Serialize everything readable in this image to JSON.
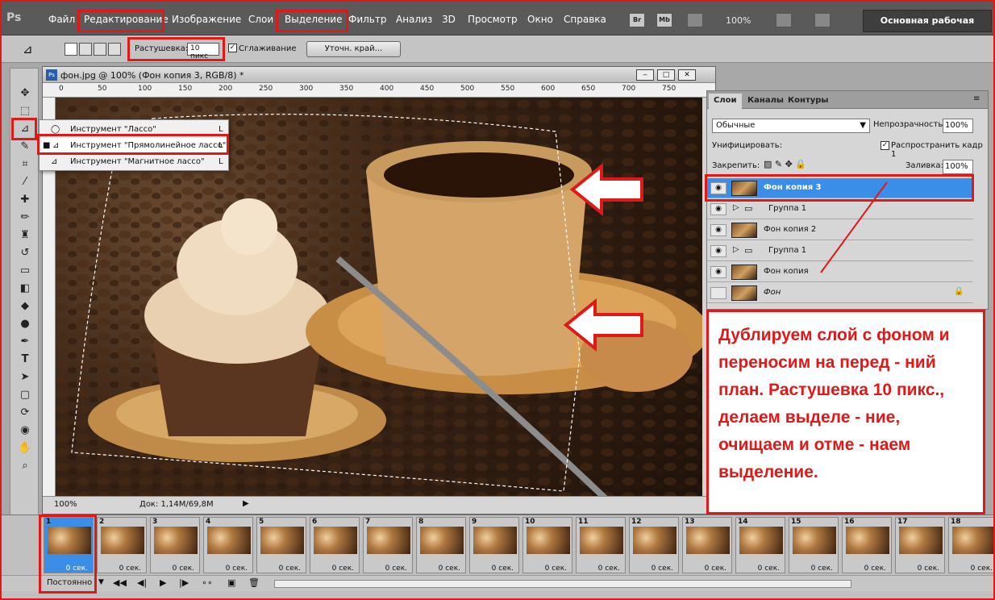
{
  "app": {
    "logo": "Ps"
  },
  "menu": [
    "Файл",
    "Редактирование",
    "Изображение",
    "Слои",
    "Выделение",
    "Фильтр",
    "Анализ",
    "3D",
    "Просмотр",
    "Окно",
    "Справка"
  ],
  "menu_right": {
    "br": "Br",
    "mb": "Mb",
    "zoom": "100%",
    "workspace": "Основная рабочая среда"
  },
  "options": {
    "feather_label": "Растушевка:",
    "feather_value": "10 пикс",
    "antialias_label": "Сглаживание",
    "refine_button": "Уточн. край..."
  },
  "document": {
    "title": "фон.jpg @ 100% (Фон копия 3, RGB/8) *",
    "zoom": "100%",
    "doc_size": "Док: 1,14М/69,8М",
    "ruler_ticks": [
      "0",
      "50",
      "100",
      "150",
      "200",
      "250",
      "300",
      "350",
      "400",
      "450",
      "500",
      "550",
      "600",
      "650",
      "700",
      "750"
    ]
  },
  "flyout": {
    "items": [
      {
        "label": "Инструмент \"Лассо\"",
        "key": "L"
      },
      {
        "label": "Инструмент \"Прямолинейное лассо\"",
        "key": "L"
      },
      {
        "label": "Инструмент \"Магнитное лассо\"",
        "key": "L"
      }
    ]
  },
  "layers_panel": {
    "tabs": [
      "Слои",
      "Каналы",
      "Контуры"
    ],
    "blend_mode": "Обычные",
    "opacity_label": "Непрозрачность:",
    "opacity_value": "100%",
    "unify_label": "Унифицировать:",
    "propagate_label": "Распространить кадр 1",
    "lock_label": "Закрепить:",
    "fill_label": "Заливка:",
    "fill_value": "100%",
    "layers": [
      {
        "name": "Фон копия 3",
        "selected": true
      },
      {
        "name": "Группа 1",
        "group": true
      },
      {
        "name": "Фон копия 2"
      },
      {
        "name": "Группа 1",
        "group": true
      },
      {
        "name": "Фон копия"
      },
      {
        "name": "Фон",
        "locked": true
      }
    ]
  },
  "annotation": "Дублируем слой с фоном и переносим на перед - ний план. Растушевка 10 пикс., делаем выделе - ние, очищаем и отме - наем выделение.",
  "timeline": {
    "frames": [
      {
        "num": "1",
        "time": "0 сек."
      },
      {
        "num": "2",
        "time": "0 сек."
      },
      {
        "num": "3",
        "time": "0 сек."
      },
      {
        "num": "4",
        "time": "0 сек."
      },
      {
        "num": "5",
        "time": "0 сек."
      },
      {
        "num": "6",
        "time": "0 сек."
      },
      {
        "num": "7",
        "time": "0 сек."
      },
      {
        "num": "8",
        "time": "0 сек."
      },
      {
        "num": "9",
        "time": "0 сек."
      },
      {
        "num": "10",
        "time": "0 сек."
      },
      {
        "num": "11",
        "time": "0 сек."
      },
      {
        "num": "12",
        "time": "0 сек."
      },
      {
        "num": "13",
        "time": "0 сек."
      },
      {
        "num": "14",
        "time": "0 сек."
      },
      {
        "num": "15",
        "time": "0 сек."
      },
      {
        "num": "16",
        "time": "0 сек."
      },
      {
        "num": "17",
        "time": "0 сек."
      },
      {
        "num": "18",
        "time": "0 сек."
      }
    ],
    "loop": "Постоянно"
  },
  "colors": {
    "accent": "#e01818",
    "selected_layer": "#3a8ee8"
  }
}
